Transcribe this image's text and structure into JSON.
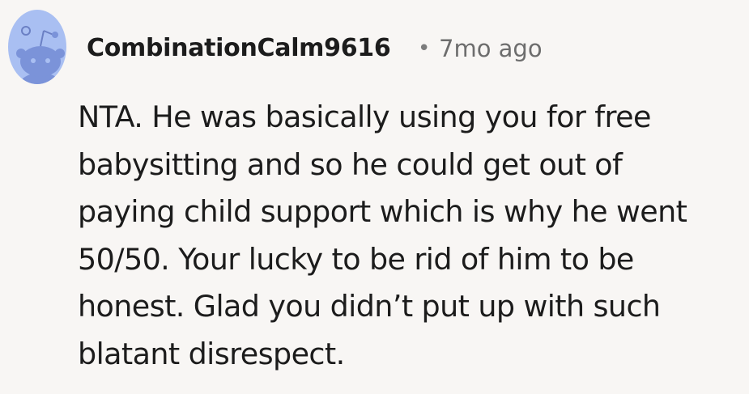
{
  "comment": {
    "author": "CombinationCalm9616",
    "separator": "•",
    "timestamp": "7mo ago",
    "avatar_icon": "reddit-snoo-avatar-icon",
    "body": "NTA. He was basically using you for free\nbabysitting and so he could get out of\npaying child support which is why he went\n50/50. Your lucky to be rid of him to be\nhonest. Glad you didn’t put up with such\nblatant disrespect."
  },
  "colors": {
    "background": "#f8f6f4",
    "avatar_bg": "#a9bff2",
    "avatar_snoo": "#7b93d9",
    "text": "#1c1c1c",
    "muted": "#6d6d6d"
  }
}
